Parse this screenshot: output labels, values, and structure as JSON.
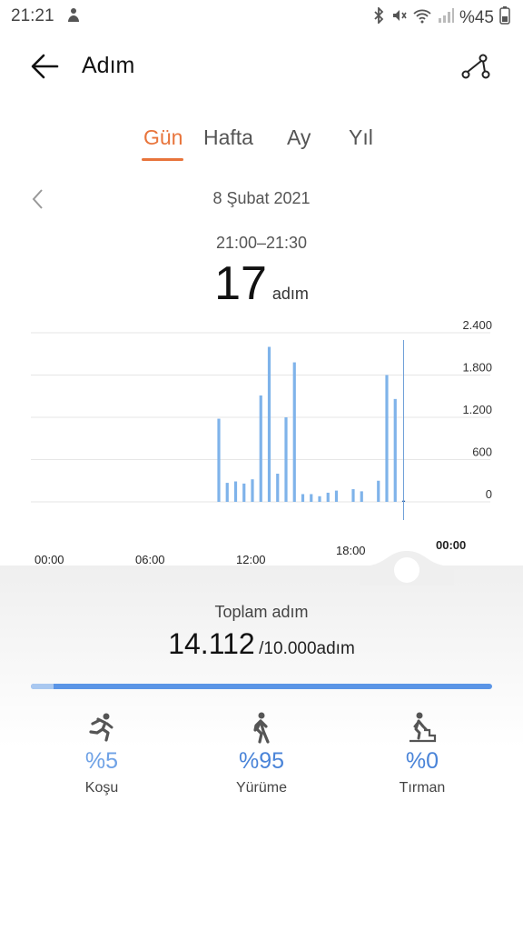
{
  "status_bar": {
    "time": "21:21",
    "battery": "%45",
    "icons": [
      "person-icon",
      "bluetooth-icon",
      "mute-icon",
      "wifi-icon",
      "signal-icon",
      "battery-icon"
    ]
  },
  "header": {
    "title": "Adım",
    "back_icon": "back-arrow-icon",
    "share_icon": "share-icon"
  },
  "tabs": [
    {
      "label": "Gün",
      "active": true
    },
    {
      "label": "Hafta",
      "active": false
    },
    {
      "label": "Ay",
      "active": false
    },
    {
      "label": "Yıl",
      "active": false
    }
  ],
  "date": "8 Şubat 2021",
  "selected": {
    "range": "21:00–21:30",
    "value": "17",
    "unit": "adım"
  },
  "chart_data": {
    "type": "bar",
    "y_ticks": [
      "2.400",
      "1.800",
      "1.200",
      "600",
      "0"
    ],
    "ylim": [
      0,
      2400
    ],
    "x_tick_labels": [
      "00:00",
      "06:00",
      "12:00",
      "18:00",
      "00:00"
    ],
    "x_range_hours": [
      0,
      24
    ],
    "bars": [
      {
        "h": 10.0,
        "v": 1180
      },
      {
        "h": 10.5,
        "v": 270
      },
      {
        "h": 11.0,
        "v": 290
      },
      {
        "h": 11.5,
        "v": 260
      },
      {
        "h": 12.0,
        "v": 320
      },
      {
        "h": 12.5,
        "v": 1510
      },
      {
        "h": 13.0,
        "v": 2200
      },
      {
        "h": 13.5,
        "v": 400
      },
      {
        "h": 14.0,
        "v": 1200
      },
      {
        "h": 14.5,
        "v": 1980
      },
      {
        "h": 15.0,
        "v": 110
      },
      {
        "h": 15.5,
        "v": 110
      },
      {
        "h": 16.0,
        "v": 80
      },
      {
        "h": 16.5,
        "v": 130
      },
      {
        "h": 17.0,
        "v": 160
      },
      {
        "h": 18.0,
        "v": 180
      },
      {
        "h": 18.5,
        "v": 150
      },
      {
        "h": 19.5,
        "v": 300
      },
      {
        "h": 20.0,
        "v": 1800
      },
      {
        "h": 20.5,
        "v": 1460
      },
      {
        "h": 21.0,
        "v": 17
      }
    ],
    "selected_hour": 21.0,
    "bar_color": "#7fb3ea"
  },
  "summary": {
    "label": "Toplam adım",
    "value": "14.112",
    "goal": "/10.000adım",
    "progress": 0.05
  },
  "activities": [
    {
      "pct": "%5",
      "label": "Koşu",
      "icon": "running-icon"
    },
    {
      "pct": "%95",
      "label": "Yürüme",
      "icon": "walking-icon"
    },
    {
      "pct": "%0",
      "label": "Tırman",
      "icon": "climbing-icon"
    }
  ],
  "colors": {
    "accent": "#e8743b",
    "bar": "#7fb3ea",
    "progress": "#5b95e6"
  }
}
